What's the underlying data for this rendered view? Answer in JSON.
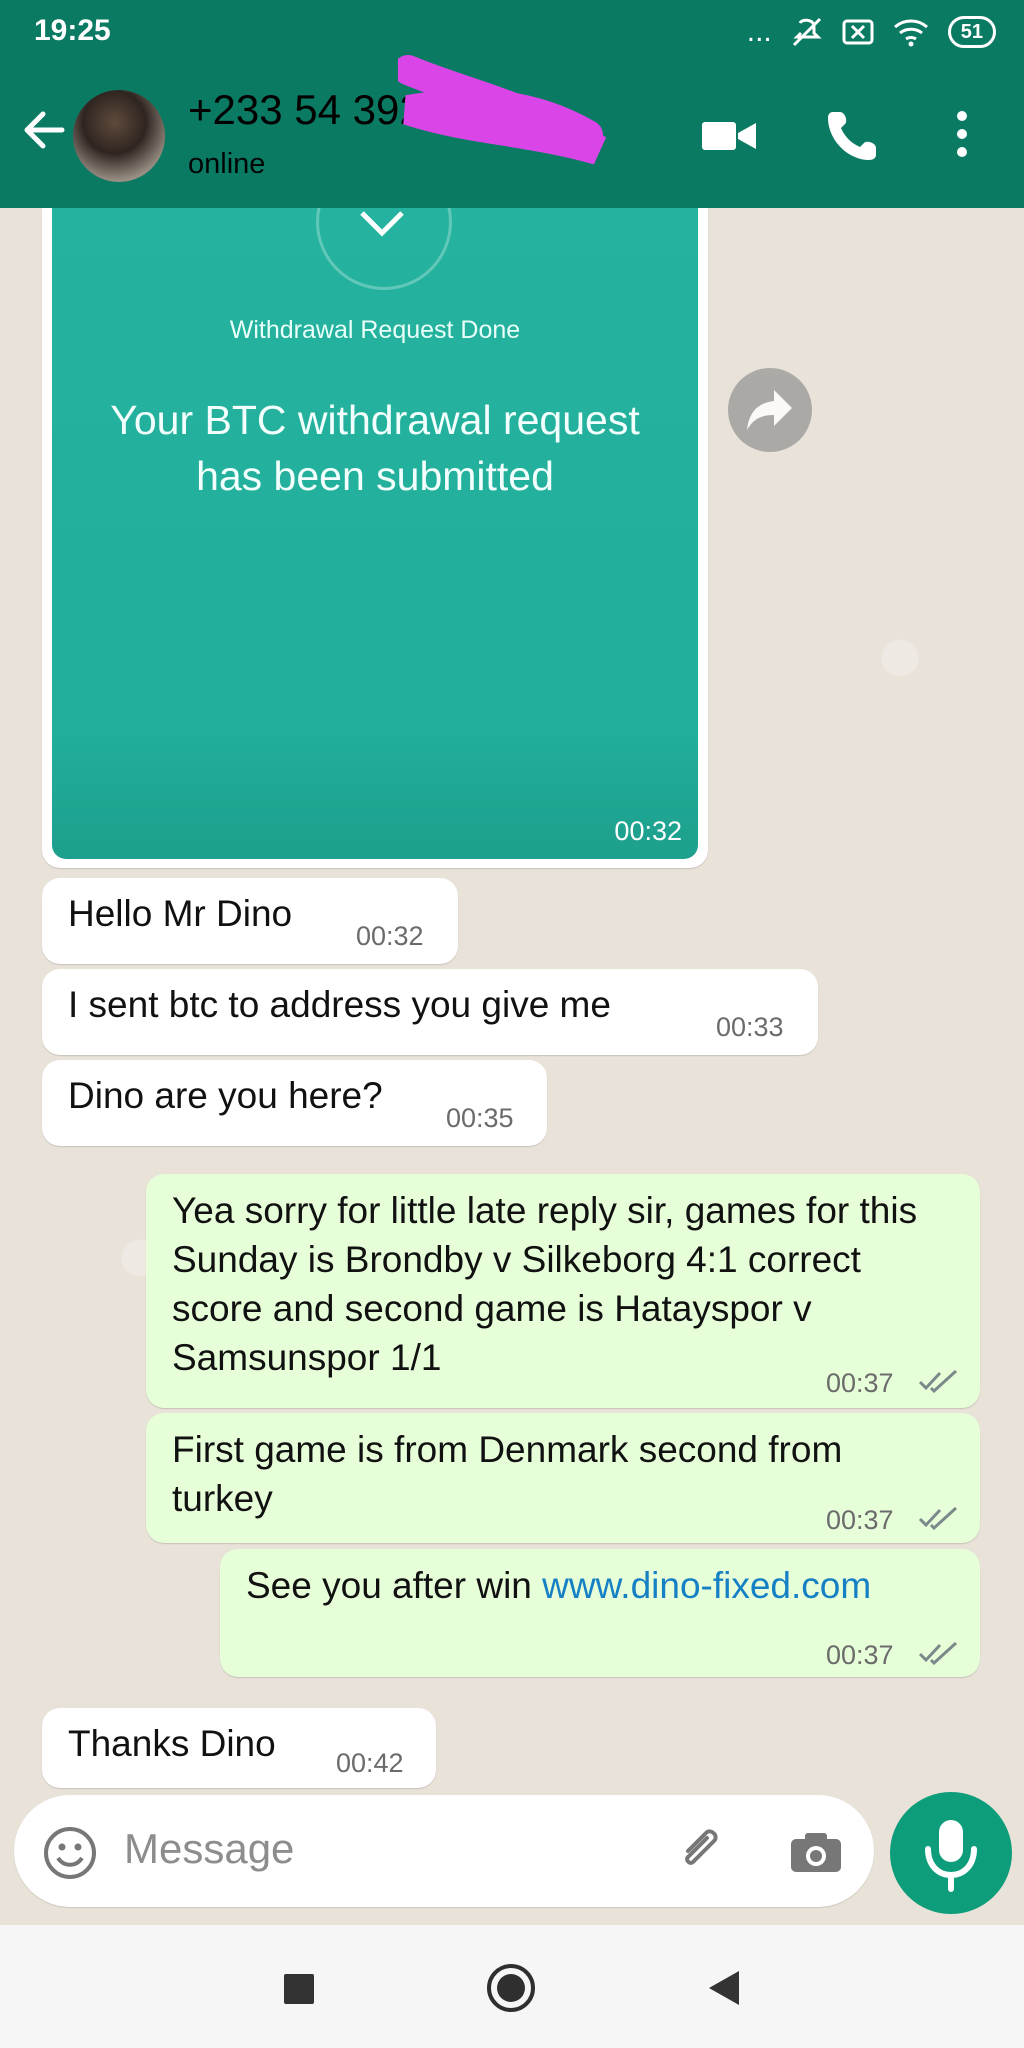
{
  "status": {
    "time": "19:25",
    "battery": "51",
    "dots": "..."
  },
  "contact": {
    "name": "+233 54 392 99",
    "status": "online"
  },
  "image_card": {
    "small_text": "Withdrawal Request Done",
    "big_text": "Your BTC withdrawal request has been submitted",
    "time": "00:32"
  },
  "messages": [
    {
      "text": "Hello Mr Dino",
      "time": "00:32",
      "dir": "in"
    },
    {
      "text": "I sent btc to address you give me",
      "time": "00:33",
      "dir": "in"
    },
    {
      "text": "Dino are you here?",
      "time": "00:35",
      "dir": "in"
    },
    {
      "text": "Yea sorry for little late reply sir, games for this Sunday is Brondby v Silkeborg 4:1 correct score and second game is Hatayspor v Samsunspor 1/1",
      "time": "00:37",
      "dir": "out"
    },
    {
      "text": "First game is from Denmark second from turkey",
      "time": "00:37",
      "dir": "out"
    },
    {
      "text_prefix": "See you after win",
      "link": "www.dino-fixed.com",
      "time": "00:37",
      "dir": "out"
    },
    {
      "text": "Thanks Dino",
      "time": "00:42",
      "dir": "in"
    }
  ],
  "composer": {
    "placeholder": "Message"
  },
  "icons": {
    "back": "back-arrow-icon",
    "video": "video-camera-icon",
    "call": "phone-icon",
    "more": "more-vert-icon",
    "forward": "forward-icon",
    "emoji": "emoji-icon",
    "attach": "paperclip-icon",
    "camera": "camera-icon",
    "mic": "microphone-icon",
    "recents": "recents-icon",
    "home": "home-icon",
    "nav_back": "nav-back-icon"
  },
  "colors": {
    "header": "#0b7a63",
    "chat_bg": "#e9e2d9",
    "outgoing": "#e6ffd9",
    "incoming": "#ffffff",
    "link": "#1580c4",
    "mic": "#0d9d7b"
  }
}
